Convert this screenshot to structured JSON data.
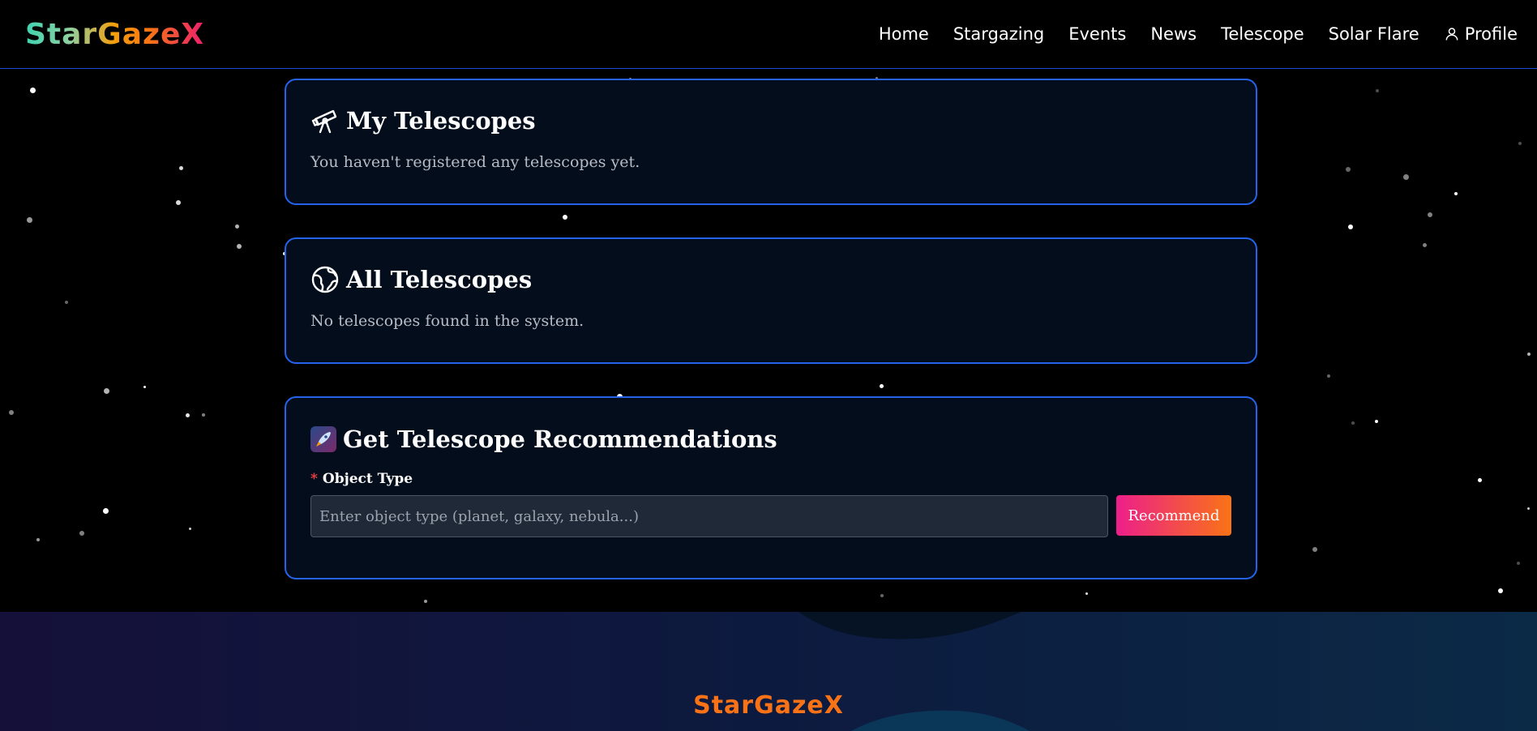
{
  "brand": {
    "logo": "StarGazeX"
  },
  "nav": {
    "items": [
      {
        "label": "Home"
      },
      {
        "label": "Stargazing"
      },
      {
        "label": "Events"
      },
      {
        "label": "News"
      },
      {
        "label": "Telescope"
      },
      {
        "label": "Solar Flare"
      },
      {
        "label": "Profile",
        "icon": "user-icon"
      }
    ]
  },
  "my_telescopes": {
    "icon": "telescope-icon",
    "title": "My Telescopes",
    "empty_text": "You haven't registered any telescopes yet."
  },
  "all_telescopes": {
    "icon": "globe-icon",
    "title": "All Telescopes",
    "empty_text": "No telescopes found in the system."
  },
  "recommendations": {
    "icon": "rocket-icon",
    "title": "Get Telescope Recommendations",
    "field_label": "Object Type",
    "required_mark": "*",
    "input_value": "",
    "input_placeholder": "Enter object type (planet, galaxy, nebula...)",
    "button_label": "Recommend"
  },
  "footer": {
    "logo": "StarGazeX"
  },
  "colors": {
    "accent_border": "#2563eb",
    "card_bg": "#040d1c",
    "button_gradient_start": "#ec1f8a",
    "button_gradient_end": "#f97316",
    "footer_logo": "#f97316"
  }
}
